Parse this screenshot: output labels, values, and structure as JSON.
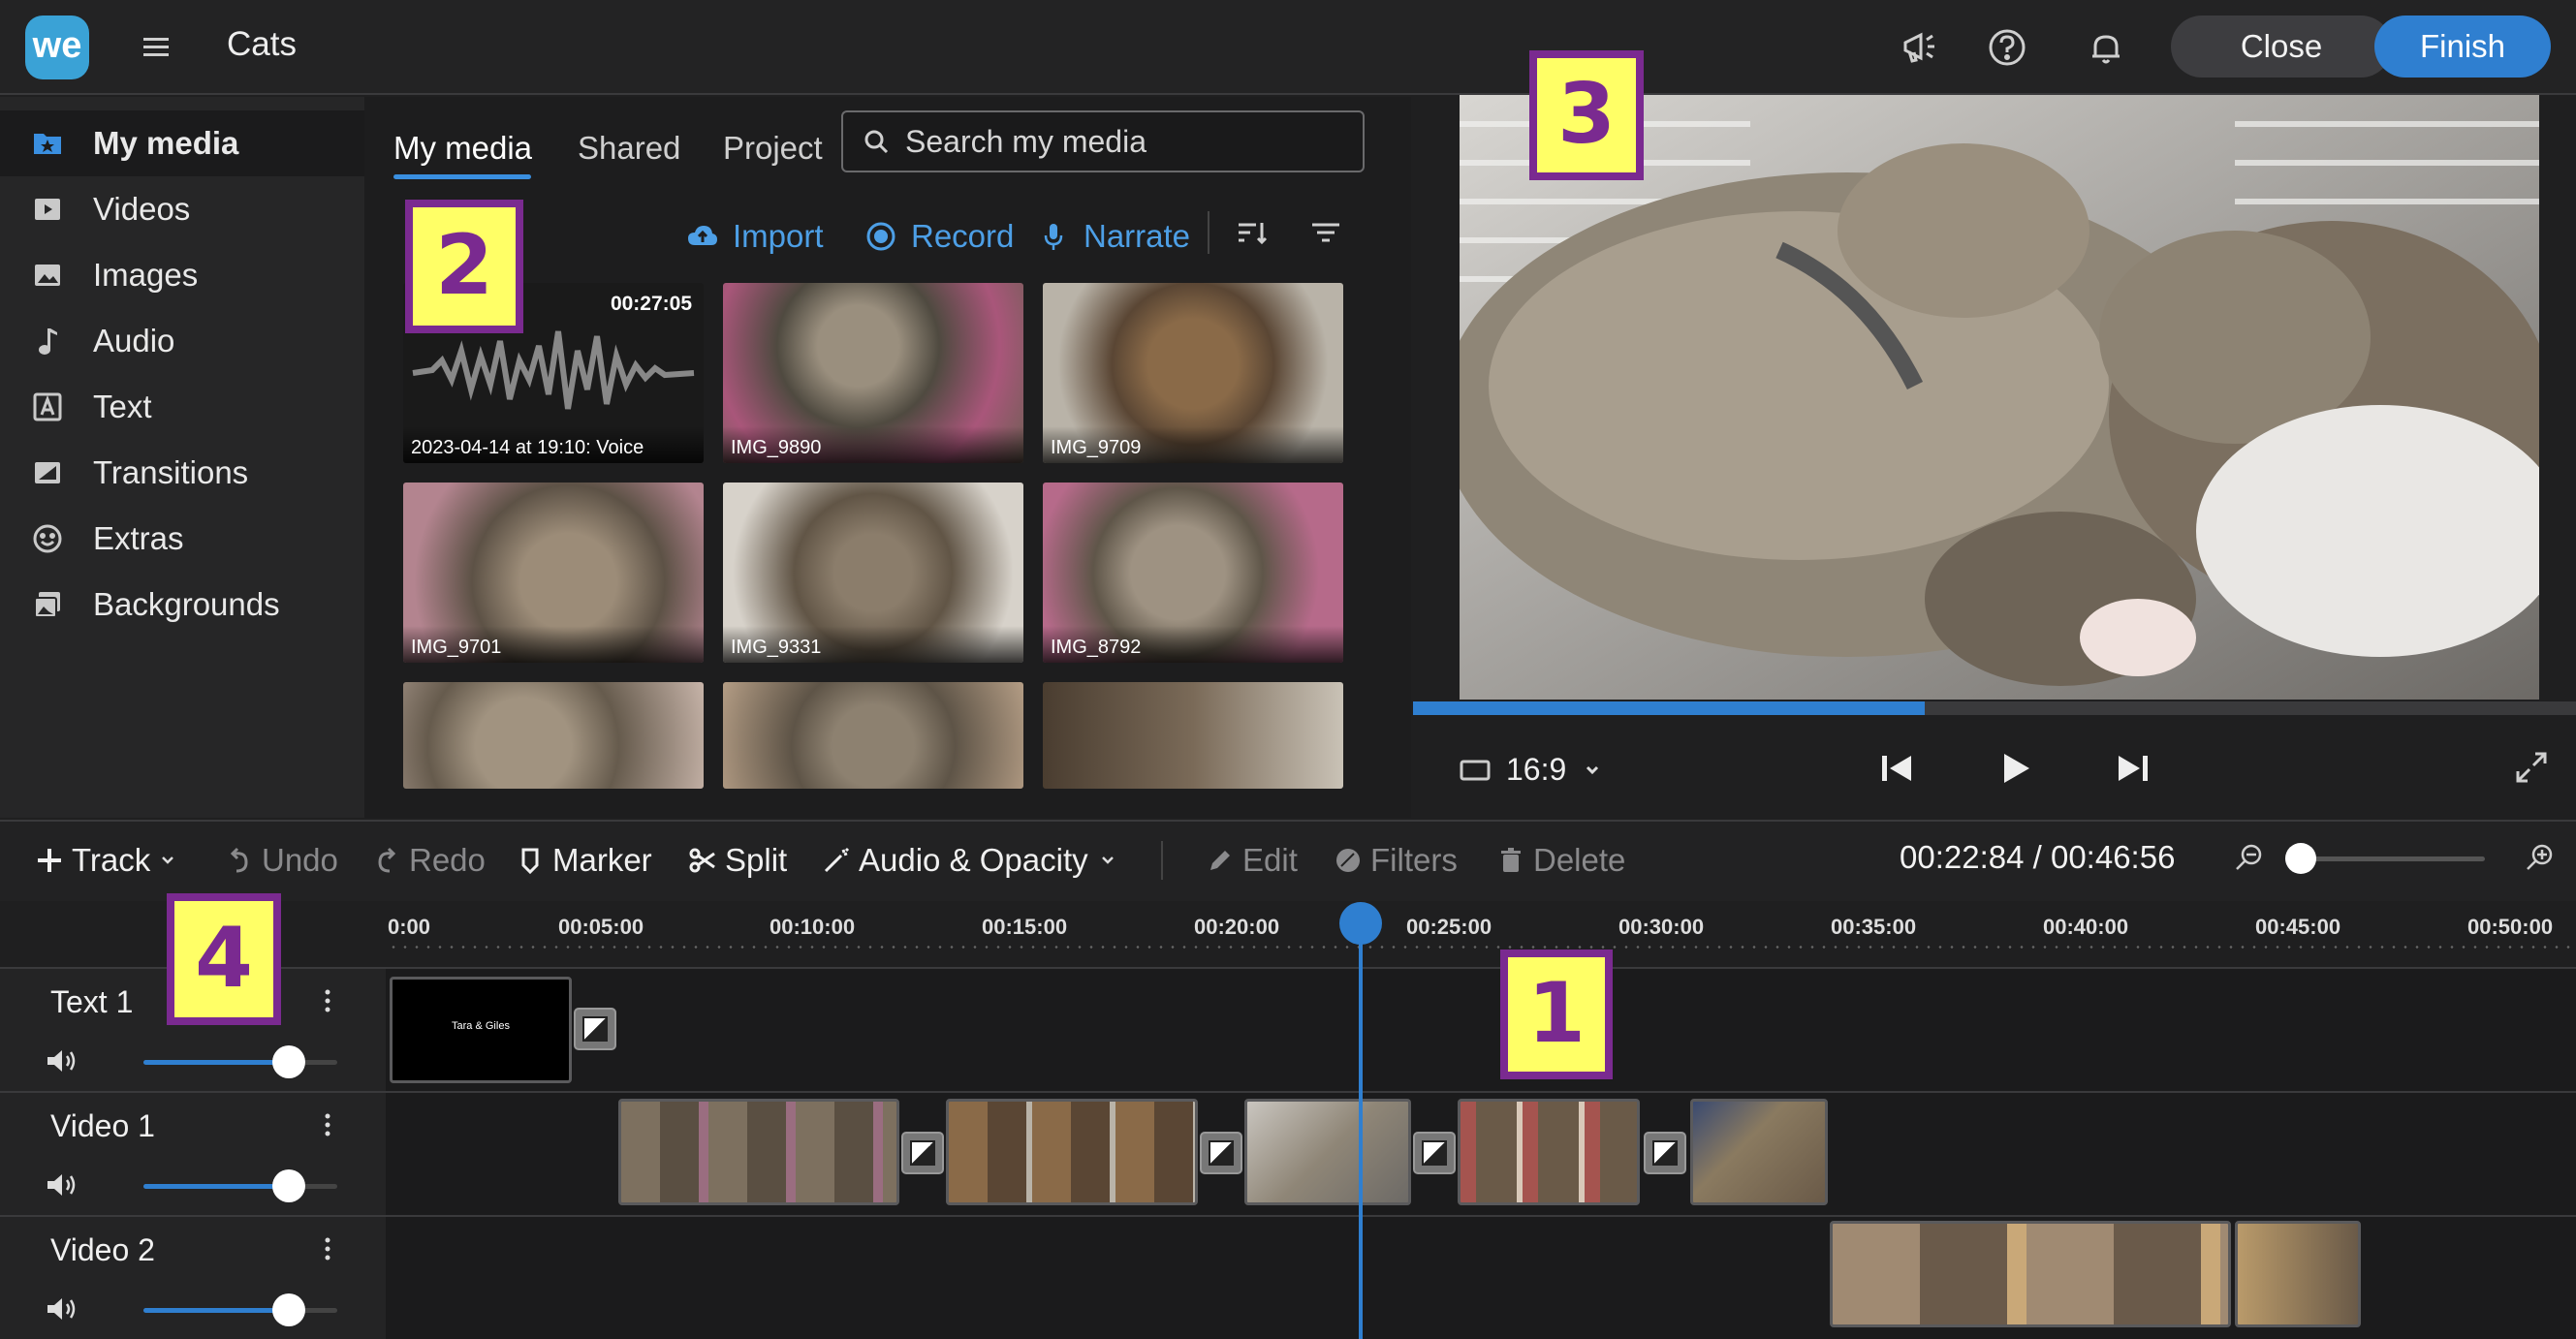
{
  "header": {
    "logo": "we",
    "title": "Cats",
    "close_label": "Close",
    "finish_label": "Finish"
  },
  "sidebar": {
    "items": [
      {
        "label": "My media",
        "icon": "star-folder-icon"
      },
      {
        "label": "Videos",
        "icon": "video-icon"
      },
      {
        "label": "Images",
        "icon": "image-icon"
      },
      {
        "label": "Audio",
        "icon": "music-note-icon"
      },
      {
        "label": "Text",
        "icon": "text-icon"
      },
      {
        "label": "Transitions",
        "icon": "transition-icon"
      },
      {
        "label": "Extras",
        "icon": "smiley-icon"
      },
      {
        "label": "Backgrounds",
        "icon": "backgrounds-icon"
      }
    ]
  },
  "media": {
    "tabs": [
      "My media",
      "Shared",
      "Project"
    ],
    "search_placeholder": "Search my media",
    "actions": {
      "import": "Import",
      "record": "Record",
      "narrate": "Narrate"
    },
    "thumbs": [
      {
        "label": "2023-04-14 at 19:10: Voice",
        "duration": "00:27:05"
      },
      {
        "label": "IMG_9890"
      },
      {
        "label": "IMG_9709"
      },
      {
        "label": "IMG_9701"
      },
      {
        "label": "IMG_9331"
      },
      {
        "label": "IMG_8792"
      }
    ]
  },
  "preview": {
    "aspect": "16:9",
    "progress": 0.44
  },
  "toolbar": {
    "track": "Track",
    "undo": "Undo",
    "redo": "Redo",
    "marker": "Marker",
    "split": "Split",
    "audio_opacity": "Audio & Opacity",
    "edit": "Edit",
    "filters": "Filters",
    "delete": "Delete",
    "timecode": "00:22:84 / 00:46:56"
  },
  "ruler": [
    "0:00",
    "00:05:00",
    "00:10:00",
    "00:15:00",
    "00:20:00",
    "00:25:00",
    "00:30:00",
    "00:35:00",
    "00:40:00",
    "00:45:00",
    "00:50:00"
  ],
  "tracks": [
    {
      "name": "Text 1",
      "volume": 0.75
    },
    {
      "name": "Video 1",
      "volume": 0.75
    },
    {
      "name": "Video 2",
      "volume": 0.75
    }
  ],
  "text_clip": "Tara & Giles",
  "badges": [
    "1",
    "2",
    "3",
    "4"
  ],
  "colors": {
    "accent": "#2f7fd0",
    "badge_fill": "#ffff66",
    "badge_border": "#7a2a90"
  }
}
